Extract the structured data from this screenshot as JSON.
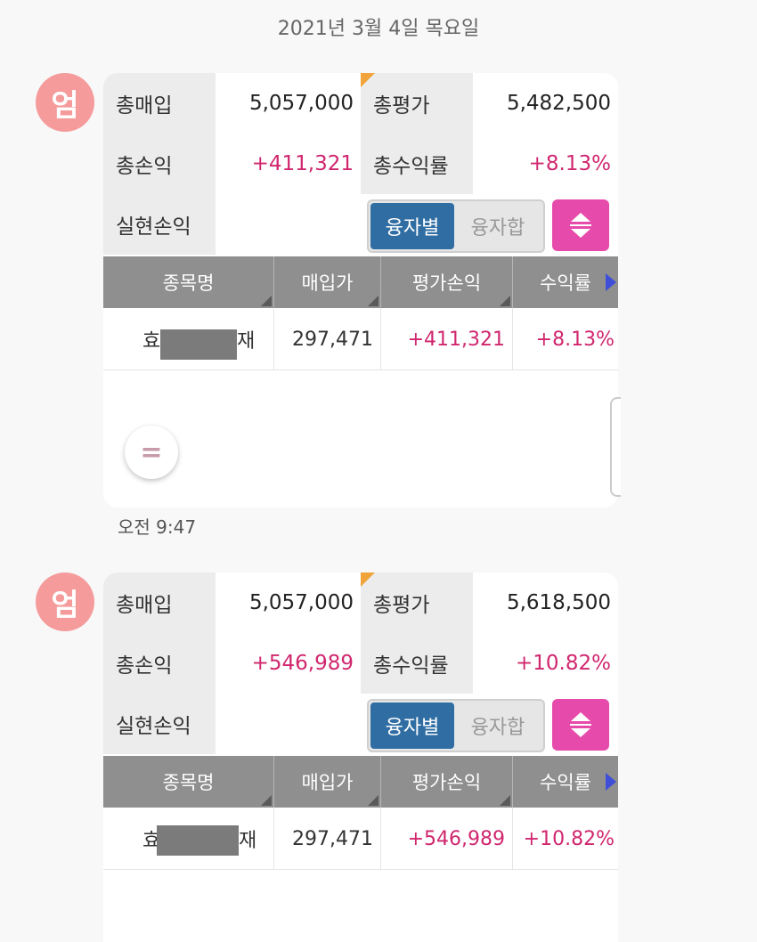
{
  "date_header": "2021년 3월 4일 목요일",
  "messages": [
    {
      "avatar": "엄",
      "summary": {
        "total_buy_label": "총매입",
        "total_buy": "5,057,000",
        "total_eval_label": "총평가",
        "total_eval": "5,482,500",
        "total_pl_label": "총손익",
        "total_pl": "+411,321",
        "total_return_label": "총수익률",
        "total_return": "+8.13%",
        "realized_label": "실현손익",
        "realized": ""
      },
      "toggle": {
        "active": "융자별",
        "inactive": "융자합"
      },
      "table": {
        "headers": [
          "종목명",
          "매입가",
          "평가손익",
          "수익률"
        ],
        "rows": [
          {
            "name_start": "효",
            "name_end": "재",
            "buy_price": "297,471",
            "pl": "+411,321",
            "return": "+8.13%"
          }
        ]
      },
      "menu_icon": "=",
      "time": "오전 9:47"
    },
    {
      "avatar": "엄",
      "summary": {
        "total_buy_label": "총매입",
        "total_buy": "5,057,000",
        "total_eval_label": "총평가",
        "total_eval": "5,618,500",
        "total_pl_label": "총손익",
        "total_pl": "+546,989",
        "total_return_label": "총수익률",
        "total_return": "+10.82%",
        "realized_label": "실현손익",
        "realized": ""
      },
      "toggle": {
        "active": "융자별",
        "inactive": "융자합"
      },
      "table": {
        "headers": [
          "종목명",
          "매입가",
          "평가손익",
          "수익률"
        ],
        "rows": [
          {
            "name_start": "효",
            "name_end": "재",
            "buy_price": "297,471",
            "pl": "+546,989",
            "return": "+10.82%"
          }
        ]
      }
    }
  ],
  "colors": {
    "positive": "#d0276e",
    "avatar": "#f59b9b",
    "toggle_active": "#2f6da3",
    "sort_button": "#e64bab"
  },
  "icons": {
    "sort": "sort-up-down-icon",
    "next": "next-column-arrow-icon",
    "corner": "corner-flag-icon"
  }
}
